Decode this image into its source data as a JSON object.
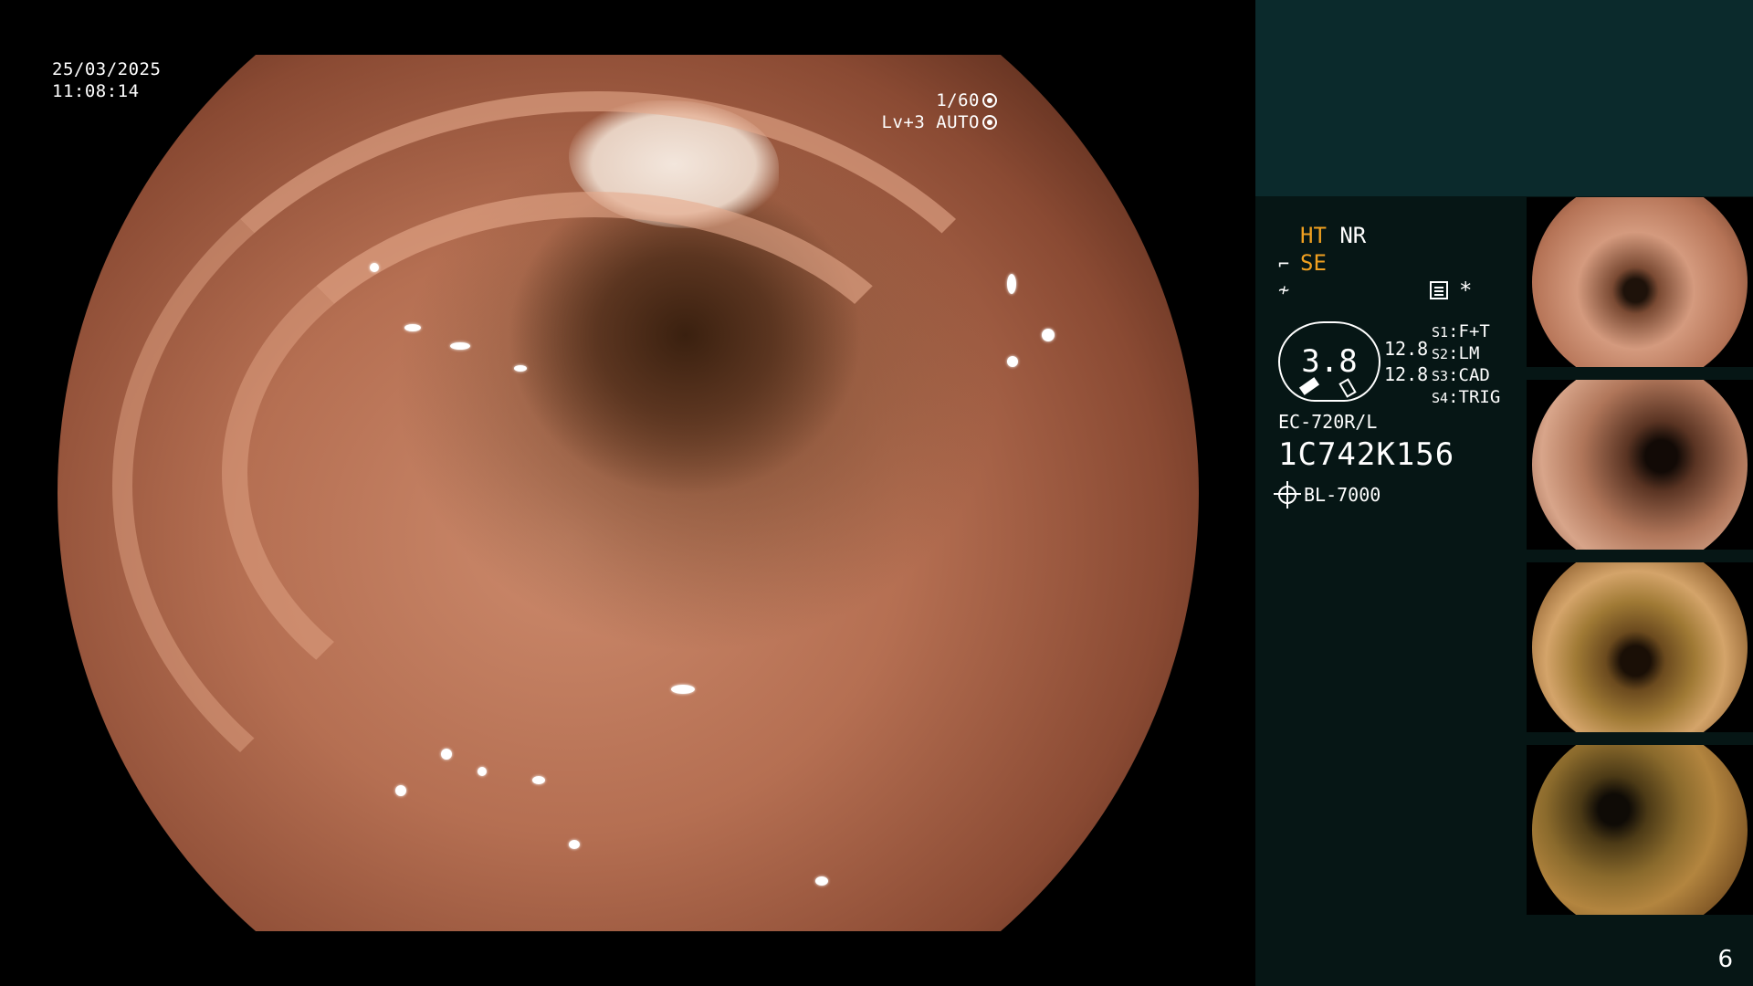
{
  "overlay": {
    "date": "25/03/2025",
    "time": "11:08:14",
    "shutter": "1/60",
    "iris": "Lv+3 AUTO"
  },
  "panel": {
    "mode_ht": "HT",
    "mode_nr": "NR",
    "mode_se": "SE",
    "gauge_value": "3.8",
    "gauge_top": "12.8",
    "gauge_bottom": "12.8",
    "slots": [
      {
        "id": "S1",
        "value": "F+T"
      },
      {
        "id": "S2",
        "value": "LM"
      },
      {
        "id": "S3",
        "value": "CAD"
      },
      {
        "id": "S4",
        "value": "TRIG"
      }
    ],
    "star": "*",
    "scope_model": "EC-720R/L",
    "scope_serial": "1C742K156",
    "light_source": "BL-7000"
  },
  "colors": {
    "panel_top": "#0b2a2c",
    "panel_body": "#061615",
    "accent_orange": "#f0a020"
  },
  "page_number": "6"
}
